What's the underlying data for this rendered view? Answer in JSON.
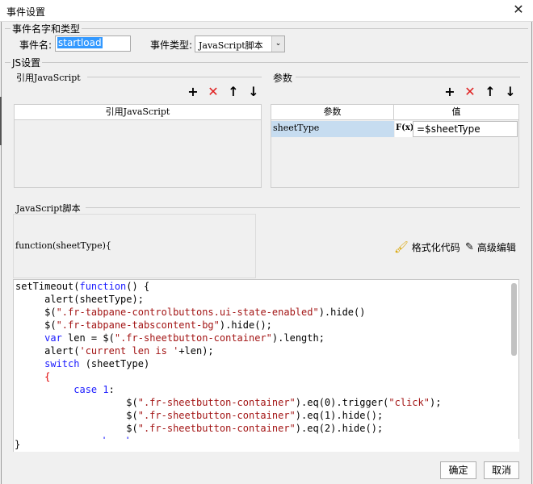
{
  "window": {
    "title": "事件设置",
    "close_glyph": "✕"
  },
  "event_group": {
    "title": "事件名字和类型",
    "name_label": "事件名:",
    "name_value": "startload",
    "type_label": "事件类型:",
    "type_value": "JavaScript脚本"
  },
  "js_group": {
    "title": "JS设置"
  },
  "ref_panel": {
    "title": "引用JavaScript",
    "column": "引用JavaScript"
  },
  "param_panel": {
    "title": "参数",
    "col_param": "参数",
    "col_value": "值",
    "rows": [
      {
        "name": "sheetType",
        "formula_icon": "F(x)",
        "value": "=$sheetType"
      }
    ]
  },
  "toolbar_icons": {
    "add": "+",
    "delete": "✕",
    "up": "↑",
    "down": "↓"
  },
  "script": {
    "title": "JavaScript脚本",
    "signature": "function(sheetType){",
    "format_label": "格式化代码",
    "advanced_label": "高级编辑",
    "closing": "}"
  },
  "buttons": {
    "ok": "确定",
    "cancel": "取消"
  }
}
